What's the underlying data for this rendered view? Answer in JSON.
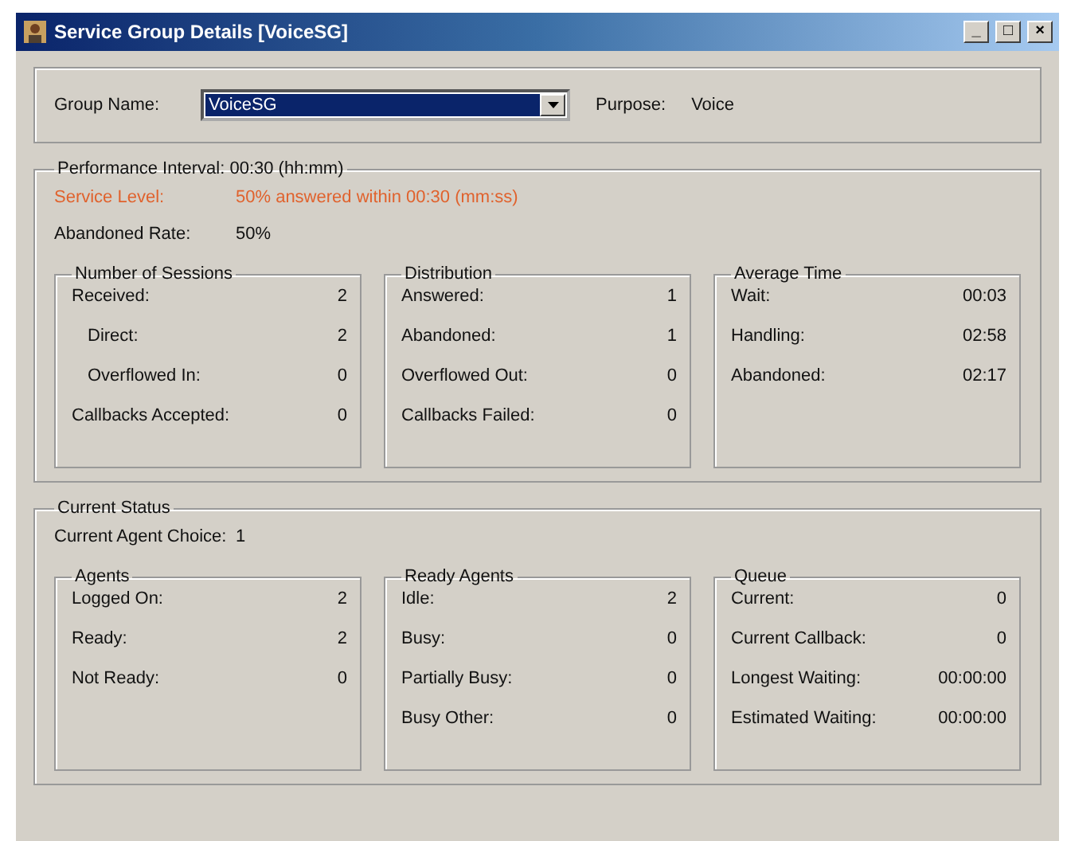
{
  "window": {
    "title": "Service Group Details [VoiceSG]",
    "controls": [
      "_",
      "□",
      "×"
    ]
  },
  "header": {
    "group_label": "Group Name:",
    "group_value": "VoiceSG",
    "group_value_selected": true,
    "purpose_label": "Purpose:",
    "purpose_value": "Voice"
  },
  "performance": {
    "title": "Performance Interval: 00:30 (hh:mm)",
    "rows": [
      {
        "label": "Service Level:",
        "value": "50% answered within 00:30 (mm:ss)",
        "alert": true
      },
      {
        "label": "Abandoned Rate:",
        "value": "50%",
        "alert": false
      }
    ],
    "groups": [
      {
        "title": "Number of Sessions",
        "items": [
          {
            "label": "Received:",
            "value": "2",
            "children": [
              {
                "label": "Direct:",
                "value": "2"
              },
              {
                "label": "Overflowed In:",
                "value": "0"
              }
            ]
          },
          {
            "label": "Callbacks Accepted:",
            "value": "0"
          }
        ]
      },
      {
        "title": "Distribution",
        "items": [
          {
            "label": "Answered:",
            "value": "1"
          },
          {
            "label": "Abandoned:",
            "value": "1"
          },
          {
            "label": "Overflowed Out:",
            "value": "0"
          },
          {
            "label": "Callbacks Failed:",
            "value": "0"
          }
        ]
      },
      {
        "title": "Average Time",
        "items": [
          {
            "label": "Wait:",
            "value": "00:03"
          },
          {
            "label": "Handling:",
            "value": "02:58"
          },
          {
            "label": "Abandoned:",
            "value": "02:17"
          }
        ]
      }
    ]
  },
  "current_status": {
    "title": "Current Status",
    "rows": [
      {
        "label": "Current Agent Choice:",
        "value": "1",
        "alert": false
      }
    ],
    "groups": [
      {
        "title": "Agents",
        "items": [
          {
            "label": "Logged On:",
            "value": "2"
          },
          {
            "label": "Ready:",
            "value": "2"
          },
          {
            "label": "Not Ready:",
            "value": "0"
          }
        ]
      },
      {
        "title": "Ready Agents",
        "items": [
          {
            "label": "Idle:",
            "value": "2"
          },
          {
            "label": "Busy:",
            "value": "0"
          },
          {
            "label": "Partially Busy:",
            "value": "0"
          },
          {
            "label": "Busy Other:",
            "value": "0"
          }
        ]
      },
      {
        "title": "Queue",
        "items": [
          {
            "label": "Current:",
            "value": "0"
          },
          {
            "label": "Current Callback:",
            "value": "0"
          },
          {
            "label": "Longest Waiting:",
            "value": "00:00:00"
          },
          {
            "label": "Estimated Waiting:",
            "value": "00:00:00"
          }
        ]
      }
    ]
  }
}
